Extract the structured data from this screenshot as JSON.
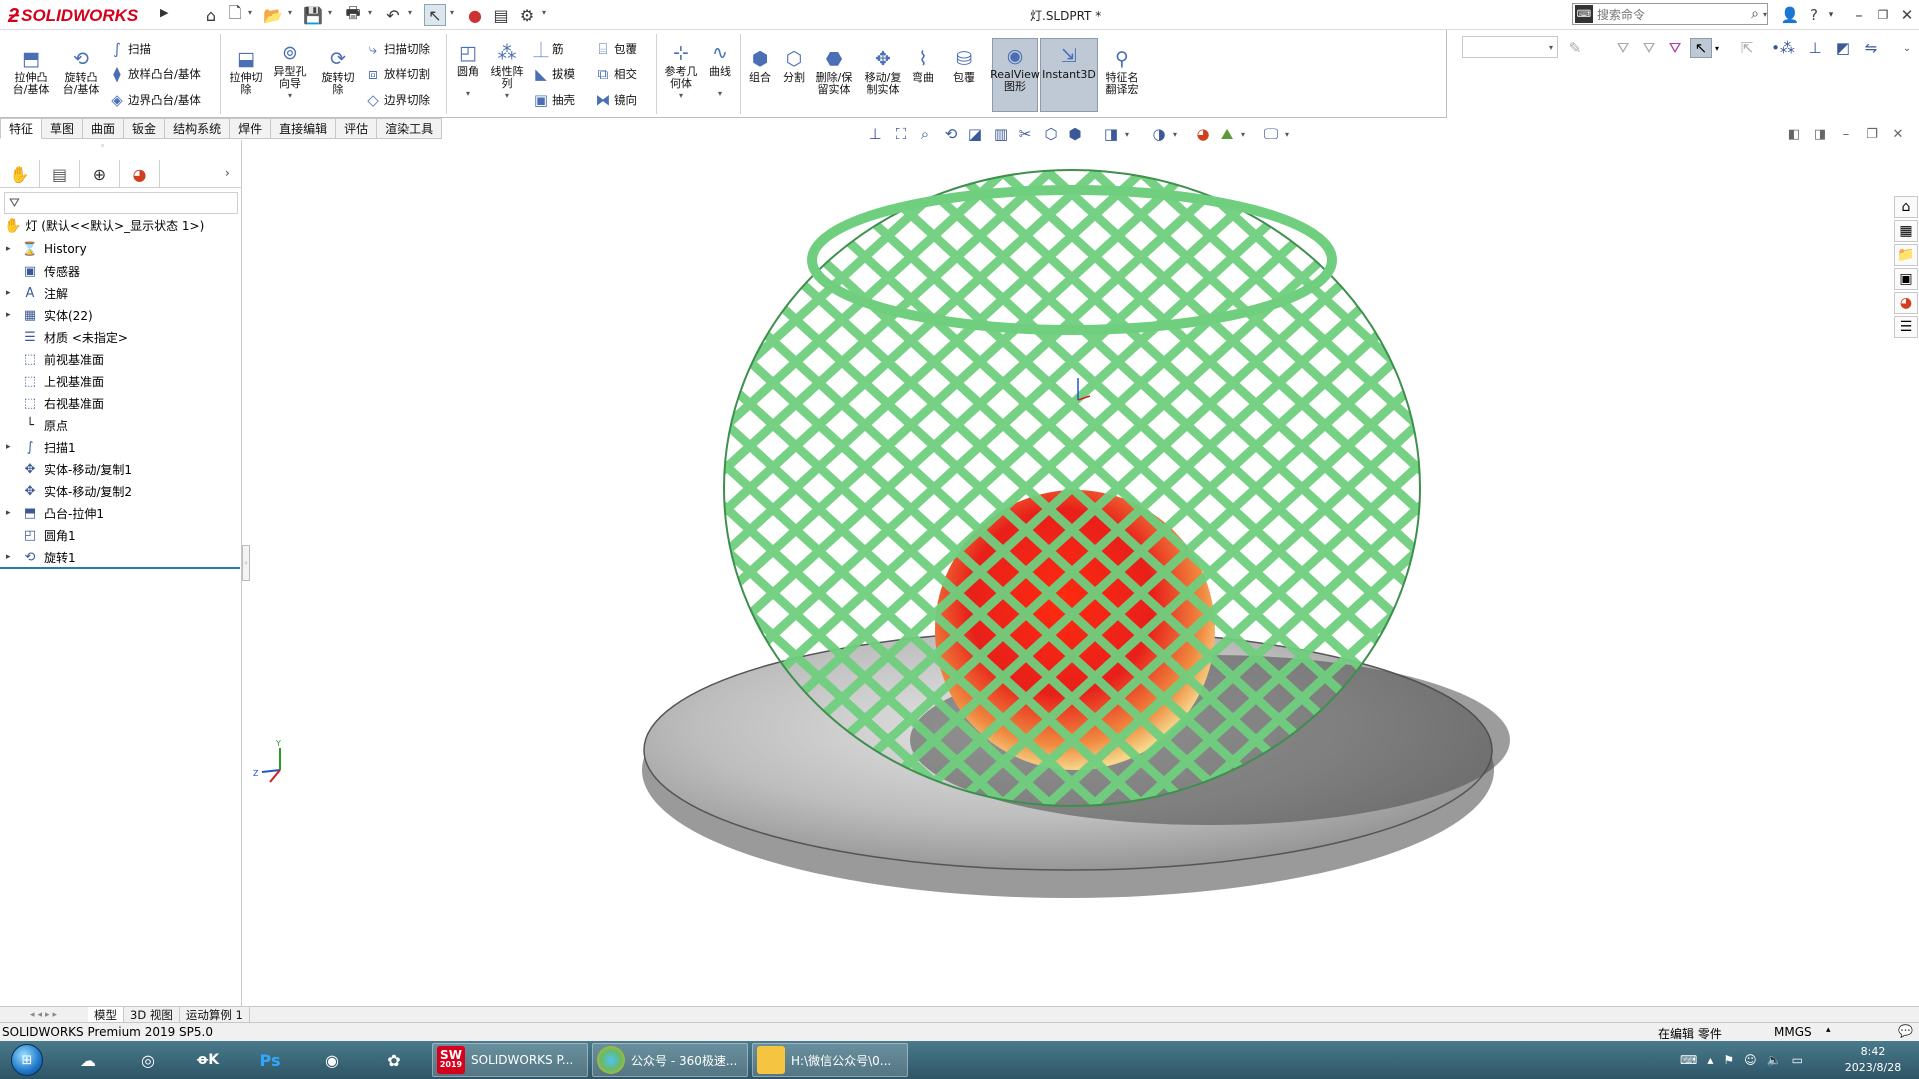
{
  "title_bar": {
    "logo": "SOLIDWORKS",
    "doc_title": "灯.SLDPRT *",
    "search_placeholder": "搜索命令"
  },
  "command_manager": {
    "extrude_boss": "拉伸凸\n台/基体",
    "revolve_boss": "旋转凸\n台/基体",
    "sweep": "扫描",
    "loft_boss": "放样凸台/基体",
    "boundary_boss": "边界凸台/基体",
    "extrude_cut": "拉伸切\n除",
    "hole_wizard": "异型孔\n向导",
    "revolve_cut": "旋转切\n除",
    "swept_cut": "扫描切除",
    "lofted_cut": "放样切割",
    "boundary_cut": "边界切除",
    "fillet": "圆角",
    "linear_pattern": "线性阵\n列",
    "rib": "筋",
    "draft": "拔模",
    "shell": "抽壳",
    "wrap": "包覆",
    "intersect": "相交",
    "mirror": "镜向",
    "ref_geometry": "参考几\n何体",
    "curves": "曲线",
    "combine": "组合",
    "split": "分割",
    "delete_keep_body": "删除/保\n留实体",
    "move_copy_body": "移动/复\n制实体",
    "flex": "弯曲",
    "wrap2": "包覆",
    "realview": "RealView\n图形",
    "instant3d": "Instant3D",
    "feature_name_translate": "特征名\n翻译宏"
  },
  "tabs": [
    "特征",
    "草图",
    "曲面",
    "钣金",
    "结构系统",
    "焊件",
    "直接编辑",
    "评估",
    "渲染工具"
  ],
  "active_tab": "特征",
  "feature_tree": {
    "root": "灯  (默认<<默认>_显示状态 1>)",
    "items": [
      {
        "label": "History",
        "icon": "history-icon",
        "expandable": true
      },
      {
        "label": "传感器",
        "icon": "sensor-icon",
        "expandable": false
      },
      {
        "label": "注解",
        "icon": "annotation-icon",
        "expandable": true
      },
      {
        "label": "实体(22)",
        "icon": "solid-bodies-icon",
        "expandable": true
      },
      {
        "label": "材质 <未指定>",
        "icon": "material-icon",
        "expandable": false
      },
      {
        "label": "前视基准面",
        "icon": "plane-icon",
        "expandable": false
      },
      {
        "label": "上视基准面",
        "icon": "plane-icon",
        "expandable": false
      },
      {
        "label": "右视基准面",
        "icon": "plane-icon",
        "expandable": false
      },
      {
        "label": "原点",
        "icon": "origin-icon",
        "expandable": false
      },
      {
        "label": "扫描1",
        "icon": "sweep-icon",
        "expandable": true
      },
      {
        "label": "实体-移动/复制1",
        "icon": "move-copy-icon",
        "expandable": false
      },
      {
        "label": "实体-移动/复制2",
        "icon": "move-copy-icon",
        "expandable": false
      },
      {
        "label": "凸台-拉伸1",
        "icon": "extrude-icon",
        "expandable": true
      },
      {
        "label": "圆角1",
        "icon": "fillet-icon",
        "expandable": false
      },
      {
        "label": "旋转1",
        "icon": "revolve-icon",
        "expandable": true
      }
    ]
  },
  "bottom_tabs": [
    "模型",
    "3D 视图",
    "运动算例 1"
  ],
  "status_bar": {
    "product": "SOLIDWORKS Premium 2019 SP5.0",
    "mode": "在编辑 零件",
    "units": "MMGS"
  },
  "taskbar": {
    "windows": [
      {
        "label": "SOLIDWORKS P...",
        "badge": "2019"
      },
      {
        "label": "公众号 - 360极速..."
      },
      {
        "label": "H:\\微信公众号\\0..."
      }
    ],
    "time": "8:42",
    "date": "2023/8/28"
  },
  "triad_labels": {
    "y": "Y",
    "z": "Z"
  },
  "colors": {
    "brand_red": "#d6001c",
    "cage_green": "#6fcf7f",
    "sphere_red": "#e8201a",
    "base_gray": "#b8b8b8"
  }
}
